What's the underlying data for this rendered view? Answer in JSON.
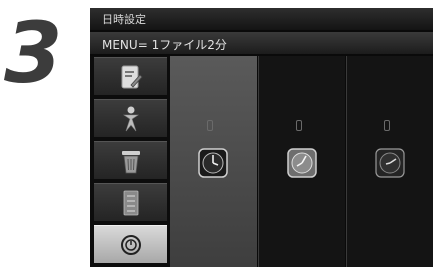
{
  "step": "3",
  "header": {
    "title": "日時設定",
    "subtitle": "MENU= 1ファイル2分"
  },
  "sidebar": {
    "items": [
      {
        "icon": "edit-icon",
        "selected": false
      },
      {
        "icon": "figure-icon",
        "selected": false
      },
      {
        "icon": "trash-icon",
        "selected": false
      },
      {
        "icon": "list-icon",
        "selected": false
      },
      {
        "icon": "clock-setting-icon",
        "selected": true
      }
    ]
  },
  "options": [
    {
      "icon": "clock-icon",
      "highlighted": true
    },
    {
      "icon": "clock-icon",
      "highlighted": false
    },
    {
      "icon": "clock-icon",
      "highlighted": false
    }
  ],
  "colors": {
    "screen_bg": "#0a0a0a",
    "selected_tab": "#c8c8c8",
    "highlighted_column": "#4c4c4c"
  }
}
